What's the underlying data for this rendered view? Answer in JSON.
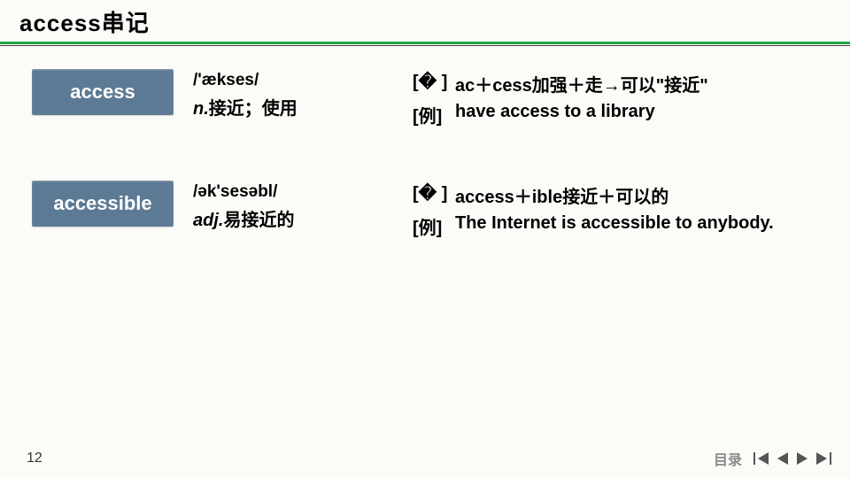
{
  "title": "access串记",
  "entries": [
    {
      "word": "access",
      "pron": "/'ækses/",
      "pos": "n.",
      "def": "接近；使用",
      "etym_tag": "[� ]",
      "etym": "ac＋cess加强＋走→可以\"接近\"",
      "ex_tag": "[例]",
      "example": "have access to a library"
    },
    {
      "word": "accessible",
      "pron": "/ək'sesəbl/",
      "pos": "adj.",
      "def": "易接近的",
      "etym_tag": "[� ]",
      "etym": "access＋ible接近＋可以的",
      "ex_tag": "[例]",
      "example": "The Internet is accessible to anybody."
    }
  ],
  "footer": {
    "page": "12",
    "toc": "目录"
  }
}
